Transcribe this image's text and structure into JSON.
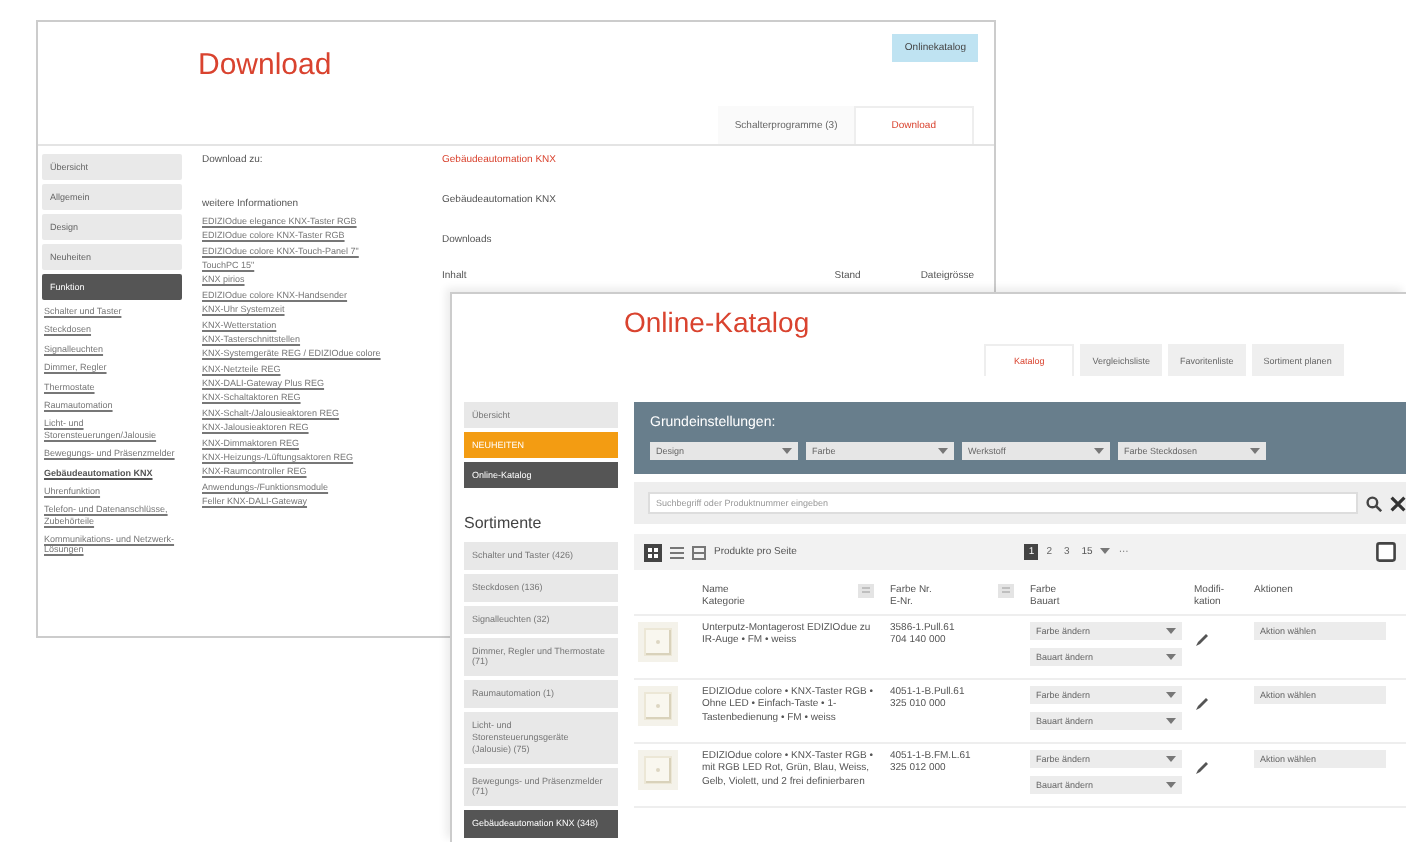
{
  "back": {
    "title": "Download",
    "top_button": "Onlinekatalog",
    "tabs": [
      {
        "label": "Schalterprogramme (3)",
        "selected": false
      },
      {
        "label": "Download",
        "selected": true
      }
    ],
    "sidebar": [
      {
        "label": "Übersicht",
        "selected": false
      },
      {
        "label": "Allgemein",
        "selected": false
      },
      {
        "label": "Design",
        "selected": false
      },
      {
        "label": "Neuheiten",
        "selected": false
      },
      {
        "label": "Funktion",
        "selected": true
      }
    ],
    "links": [
      {
        "label": "Schalter und Taster",
        "selected": false
      },
      {
        "label": "Steckdosen",
        "selected": false
      },
      {
        "label": "Signalleuchten",
        "selected": false
      },
      {
        "label": "Dimmer, Regler",
        "selected": false
      },
      {
        "label": "Thermostate",
        "selected": false
      },
      {
        "label": "Raumautomation",
        "selected": false
      },
      {
        "label": "Licht- und Storensteuerungen/Jalousie",
        "selected": false
      },
      {
        "label": "Bewegungs- und Präsenzmelder",
        "selected": false
      },
      {
        "label": "Gebäudeautomation KNX",
        "selected": true
      },
      {
        "label": "Uhrenfunktion",
        "selected": false
      },
      {
        "label": "Telefon- und Datenanschlüsse, Zubehörteile",
        "selected": false
      },
      {
        "label": "Kommunikations- und Netzwerk-Lösungen",
        "selected": false
      }
    ],
    "download_label": "Download zu:",
    "more_info_label": "weitere Informationen",
    "info_links": [
      "EDIZIOdue elegance KNX-Taster RGB",
      "EDIZIOdue colore KNX-Taster RGB",
      "EDIZIOdue colore KNX-Touch-Panel 7\"",
      "TouchPC 15\"",
      "KNX pirios",
      "EDIZIOdue colore KNX-Handsender",
      "KNX-Uhr Systemzeit",
      "KNX-Wetterstation",
      "KNX-Tasterschnittstellen",
      "KNX-Systemgeräte REG / EDIZIOdue colore",
      "KNX-Netzteile REG",
      "KNX-DALI-Gateway Plus REG",
      "KNX-Schaltaktoren REG",
      "KNX-Schalt-/Jalousieaktoren REG",
      "KNX-Jalousieaktoren REG",
      "KNX-Dimmaktoren REG",
      "KNX-Heizungs-/Lüftungsaktoren REG",
      "KNX-Raumcontroller REG",
      "Anwendungs-/Funktionsmodule",
      "Feller KNX-DALI-Gateway"
    ],
    "breadcrumb": "Gebäudeautomation KNX",
    "section_title": "Gebäudeautomation KNX",
    "downloads_heading": "Downloads",
    "columns": [
      "Inhalt",
      "Stand",
      "Dateigrösse"
    ]
  },
  "front": {
    "title": "Online-Katalog",
    "tabs": [
      {
        "label": "Katalog",
        "selected": true
      },
      {
        "label": "Vergleichsliste",
        "selected": false
      },
      {
        "label": "Favoritenliste",
        "selected": false
      },
      {
        "label": "Sortiment planen",
        "selected": false
      }
    ],
    "nav": [
      {
        "label": "Übersicht",
        "kind": "plain"
      },
      {
        "label": "NEUHEITEN",
        "kind": "highlight"
      },
      {
        "label": "Online-Katalog",
        "kind": "active"
      }
    ],
    "sortimente_heading": "Sortimente",
    "categories": [
      {
        "label": "Schalter und Taster (426)",
        "selected": false
      },
      {
        "label": "Steckdosen (136)",
        "selected": false
      },
      {
        "label": "Signalleuchten (32)",
        "selected": false
      },
      {
        "label": "Dimmer, Regler und Thermostate (71)",
        "selected": false
      },
      {
        "label": "Raumautomation (1)",
        "selected": false
      },
      {
        "label": "Licht- und Storensteuerungsgeräte (Jalousie) (75)",
        "selected": false
      },
      {
        "label": "Bewegungs- und Präsenzmelder (71)",
        "selected": false
      },
      {
        "label": "Gebäudeautomation KNX (348)",
        "selected": true
      }
    ],
    "settings": {
      "title": "Grundeinstellungen:",
      "selects": [
        "Design",
        "Farbe",
        "Werkstoff",
        "Farbe Steckdosen"
      ]
    },
    "search": {
      "placeholder": "Suchbegriff oder Produktnummer eingeben"
    },
    "toolbar": {
      "per_page_label": "Produkte pro Seite",
      "pages": [
        {
          "label": "1",
          "selected": true
        },
        {
          "label": "2",
          "selected": false
        },
        {
          "label": "3",
          "selected": false
        }
      ],
      "per_page_value": "15",
      "more": "···"
    },
    "table": {
      "columns": [
        [
          "Name",
          "Kategorie"
        ],
        [
          "Farbe Nr.",
          "E-Nr."
        ],
        [
          "Farbe",
          "Bauart"
        ],
        [
          "Modifi-",
          "kation"
        ],
        [
          "Aktionen"
        ]
      ],
      "rows": [
        {
          "name": "Unterputz-Montagerost EDIZIOdue zu IR-Auge • FM • weiss",
          "number": "3586-1.Pull.61",
          "enr": "704 140 000",
          "color_choice": "Farbe ändern",
          "build": "Bauart ändern",
          "action": "Aktion wählen"
        },
        {
          "name": "EDIZIOdue colore • KNX-Taster RGB • Ohne LED • Einfach-Taste • 1-Tastenbedienung • FM • weiss",
          "number": "4051-1-B.Pull.61",
          "enr": "325 010 000",
          "color_choice": "Farbe ändern",
          "build": "Bauart ändern",
          "action": "Aktion wählen"
        },
        {
          "name": "EDIZIOdue colore • KNX-Taster RGB • mit RGB LED Rot, Grün, Blau, Weiss, Gelb, Violett, und 2 frei definierbaren",
          "number": "4051-1-B.FM.L.61",
          "enr": "325 012 000",
          "color_choice": "Farbe ändern",
          "build": "Bauart ändern",
          "action": "Aktion wählen"
        }
      ]
    }
  }
}
